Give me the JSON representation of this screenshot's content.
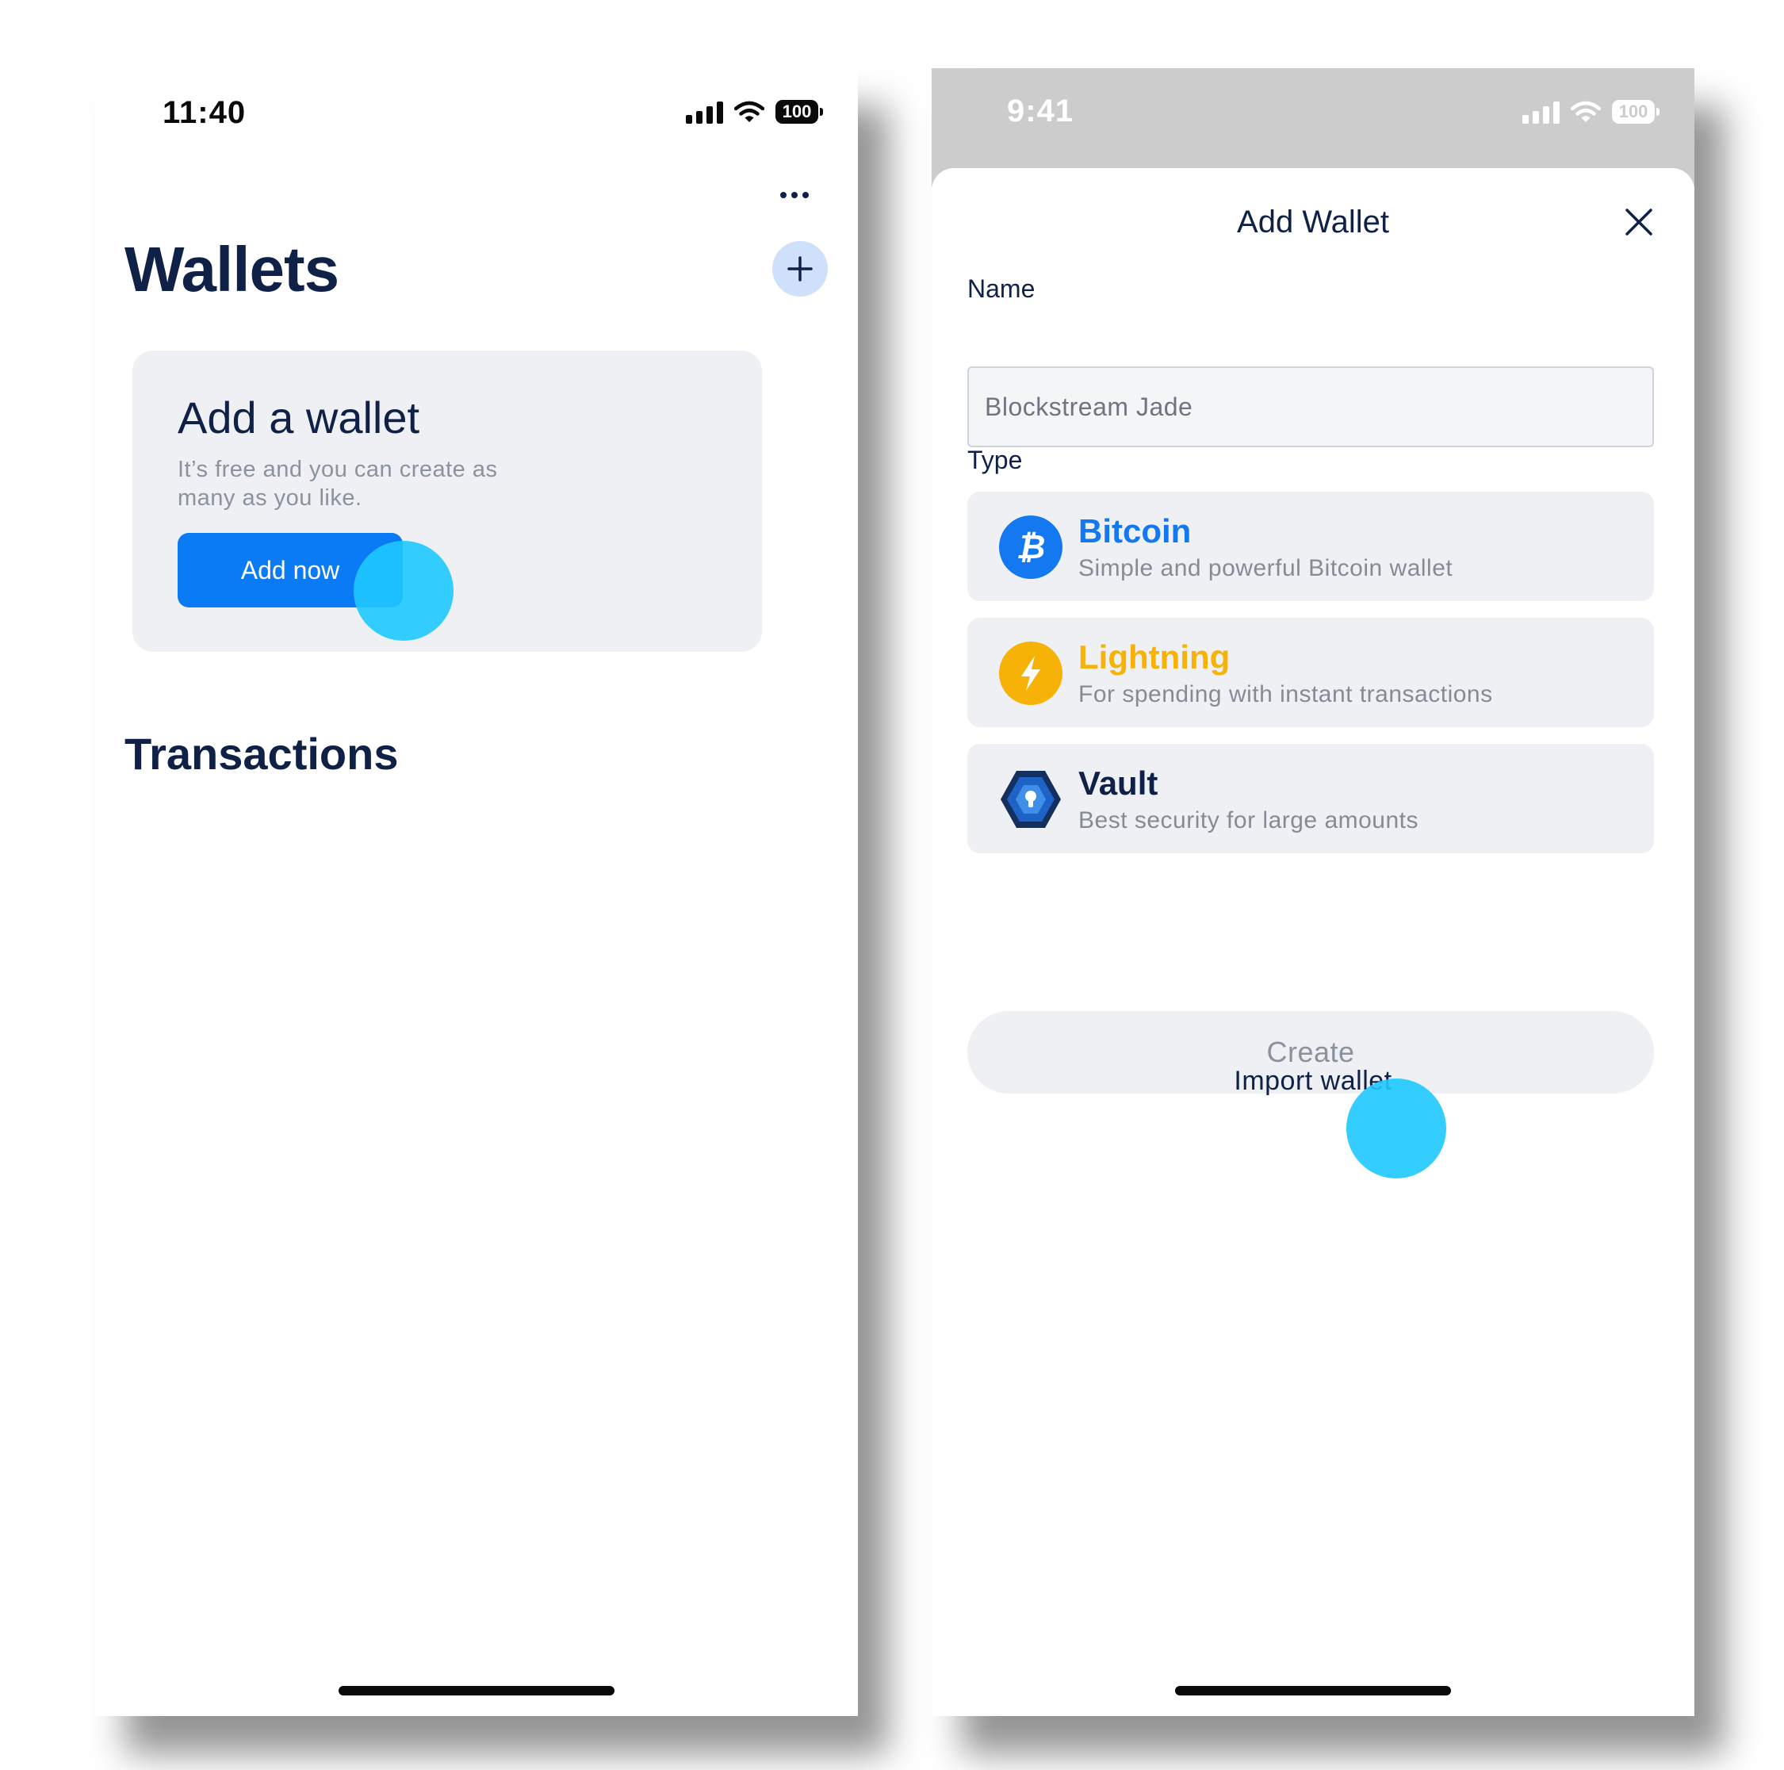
{
  "left_screen": {
    "status": {
      "time": "11:40",
      "battery": "100"
    },
    "title": "Wallets",
    "add_card": {
      "heading": "Add a wallet",
      "description": "It’s free and you can create as many as you like.",
      "button_label": "Add now"
    },
    "transactions_title": "Transactions"
  },
  "right_screen": {
    "status": {
      "time": "9:41",
      "battery": "100"
    },
    "sheet_title": "Add Wallet",
    "name_label": "Name",
    "name_placeholder": "Blockstream Jade",
    "type_label": "Type",
    "types": [
      {
        "name": "Bitcoin",
        "description": "Simple and powerful Bitcoin wallet",
        "color": "#1478f0",
        "icon": "bitcoin-icon"
      },
      {
        "name": "Lightning",
        "description": "For spending with instant transactions",
        "color": "#f7b208",
        "icon": "lightning-icon"
      },
      {
        "name": "Vault",
        "description": "Best security for large amounts",
        "color": "#0f2146",
        "icon": "vault-icon"
      }
    ],
    "create_label": "Create",
    "import_label": "Import wallet"
  },
  "colors": {
    "primary": "#0a7bf5",
    "heading": "#0f2146",
    "card_bg": "#eef0f4",
    "tap_indicator": "#1ec8ff"
  }
}
